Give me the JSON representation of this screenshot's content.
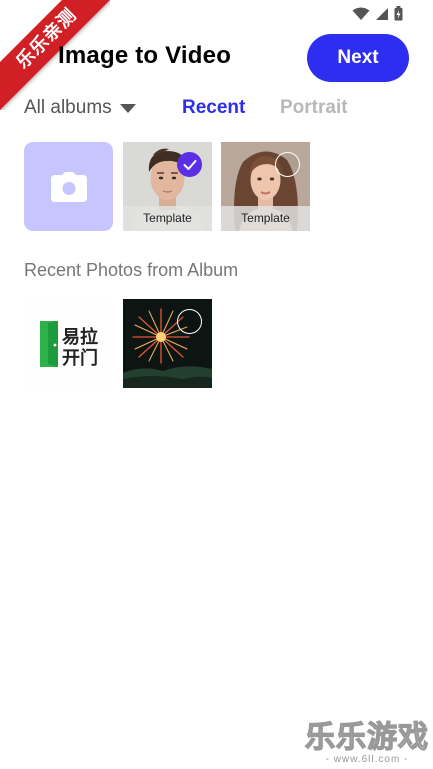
{
  "watermark_corner": {
    "text": "乐乐亲测"
  },
  "header": {
    "title": "Image to Video",
    "next_label": "Next"
  },
  "filters": {
    "album_select_label": "All albums",
    "tabs": [
      {
        "label": "Recent",
        "active": true
      },
      {
        "label": "Portrait",
        "active": false
      }
    ]
  },
  "templates": [
    {
      "label": "Template",
      "selected": true
    },
    {
      "label": "Template",
      "selected": false
    }
  ],
  "recent_section": {
    "title": "Recent Photos from Album"
  },
  "recent_photos": [
    {
      "logo_text_line1": "易拉",
      "logo_text_line2": "开门"
    },
    {
      "selected": false
    }
  ],
  "watermark_bottom": {
    "big": "乐乐游戏",
    "small": "- www.6ll.com -"
  },
  "colors": {
    "accent": "#2e2ef0",
    "camera_tile": "#c6c5ff",
    "check": "#5a2fe6"
  }
}
